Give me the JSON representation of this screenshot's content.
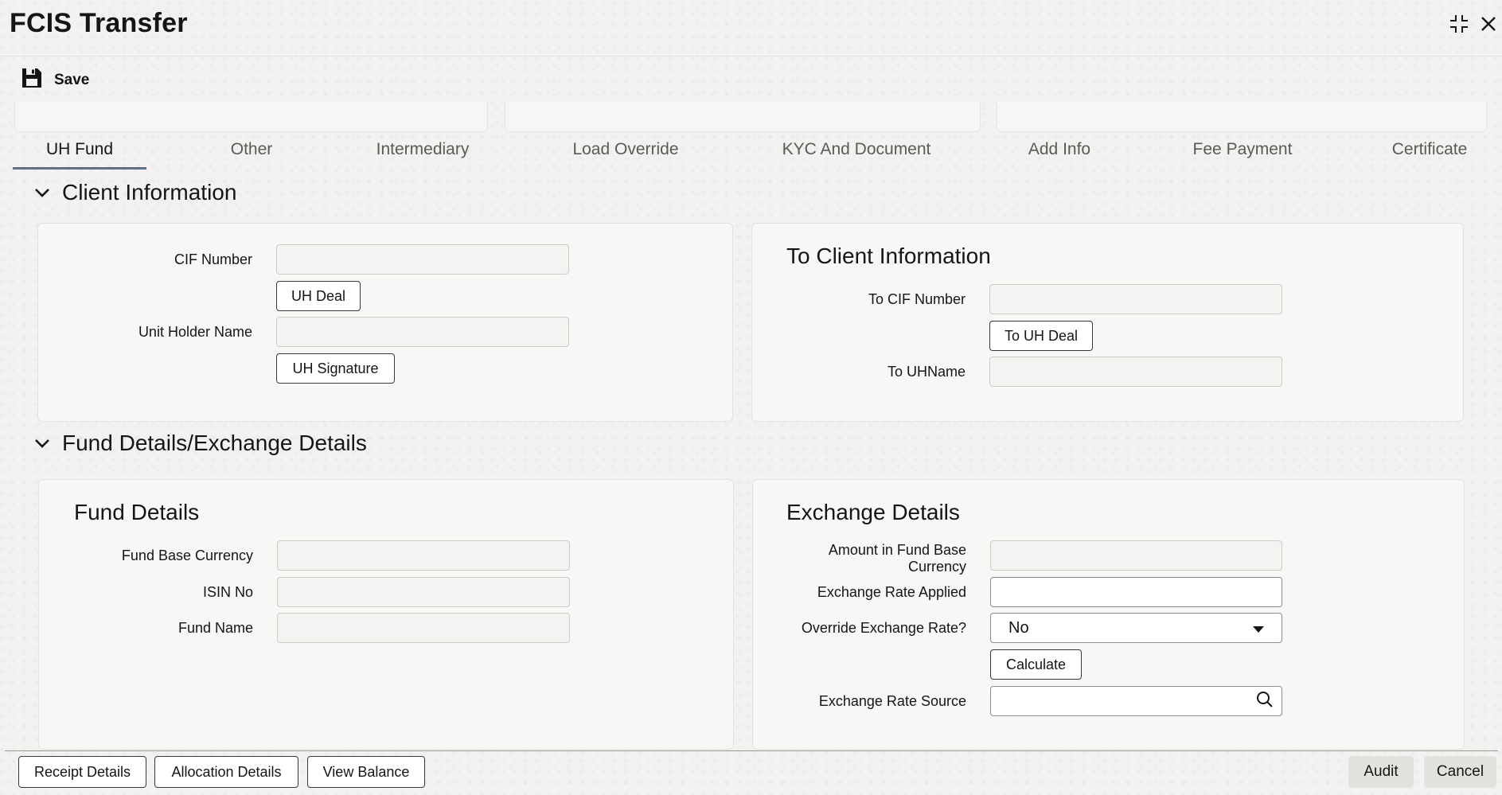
{
  "window": {
    "title": "FCIS Transfer",
    "controls": [
      "minimize-icon",
      "close-icon"
    ]
  },
  "toolbar": {
    "save_label": "Save",
    "save_icon": "floppy-disk-icon"
  },
  "tabs": [
    {
      "label": "UH Fund",
      "active": true
    },
    {
      "label": "Other",
      "active": false
    },
    {
      "label": "Intermediary",
      "active": false
    },
    {
      "label": "Load Override",
      "active": false
    },
    {
      "label": "KYC And Document",
      "active": false
    },
    {
      "label": "Add Info",
      "active": false
    },
    {
      "label": "Fee Payment",
      "active": false
    },
    {
      "label": "Certificate",
      "active": false
    }
  ],
  "client_info": {
    "header": "Client Information",
    "cif_label": "CIF Number",
    "cif_value": "",
    "uh_deal_button": "UH Deal",
    "uh_name_label": "Unit Holder Name",
    "uh_name_value": "",
    "uh_signature_button": "UH Signature"
  },
  "to_client_info": {
    "title": "To Client Information",
    "to_cif_label": "To CIF Number",
    "to_cif_value": "",
    "to_uh_deal_button": "To UH Deal",
    "to_uh_name_label": "To UHName",
    "to_uh_name_value": ""
  },
  "fund_exchange": {
    "header": "Fund Details/Exchange Details"
  },
  "fund_details": {
    "title": "Fund Details",
    "base_currency_label": "Fund Base Currency",
    "base_currency_value": "",
    "isin_label": "ISIN No",
    "isin_value": "",
    "fund_name_label": "Fund Name",
    "fund_name_value": ""
  },
  "exchange_details": {
    "title": "Exchange Details",
    "amount_label_line1": "Amount in Fund Base",
    "amount_label_line2": "Currency",
    "amount_value": "",
    "rate_applied_label": "Exchange Rate Applied",
    "rate_applied_value": "",
    "override_label": "Override Exchange Rate?",
    "override_value": "No",
    "calculate_button": "Calculate",
    "rate_source_label": "Exchange Rate Source",
    "rate_source_value": ""
  },
  "footer": {
    "receipt_details": "Receipt Details",
    "allocation_details": "Allocation Details",
    "view_balance": "View Balance",
    "audit": "Audit",
    "cancel": "Cancel"
  },
  "colors": {
    "background": "#f3f2f0",
    "panel": "#f8f7f5",
    "tab_underline": "#5f7083",
    "text": "#161513"
  }
}
